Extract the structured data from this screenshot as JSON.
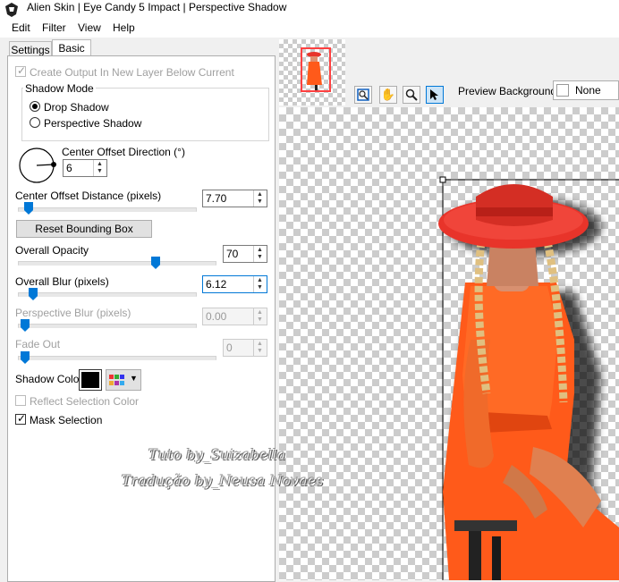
{
  "window": {
    "title": "Alien Skin | Eye Candy 5 Impact | Perspective Shadow"
  },
  "menu": [
    "Edit",
    "Filter",
    "View",
    "Help"
  ],
  "tabs": {
    "settings": "Settings",
    "basic": "Basic"
  },
  "basic": {
    "create_output": {
      "label": "Create Output In New Layer Below Current",
      "checked": true,
      "enabled": false
    },
    "shadow_mode": {
      "title": "Shadow Mode",
      "options": [
        "Drop Shadow",
        "Perspective Shadow"
      ],
      "selected": "Drop Shadow"
    },
    "center_offset_direction": {
      "label": "Center Offset Direction (°)",
      "value": "6"
    },
    "center_offset_distance": {
      "label": "Center Offset Distance (pixels)",
      "value": "7.70",
      "slider_fraction": 0.04
    },
    "reset_button": "Reset Bounding Box",
    "overall_opacity": {
      "label": "Overall Opacity",
      "value": "70",
      "slider_fraction": 0.7
    },
    "overall_blur": {
      "label": "Overall Blur (pixels)",
      "value": "6.12",
      "slider_fraction": 0.06
    },
    "perspective_blur": {
      "label": "Perspective Blur (pixels)",
      "value": "0.00",
      "slider_fraction": 0.0
    },
    "fade_out": {
      "label": "Fade Out",
      "value": "0",
      "slider_fraction": 0.0
    },
    "shadow_color": {
      "label": "Shadow Color",
      "color": "#000000"
    },
    "reflect_selection_color": {
      "label": "Reflect Selection Color",
      "checked": false
    },
    "mask_selection": {
      "label": "Mask Selection",
      "checked": true
    }
  },
  "preview": {
    "background_label": "Preview Background:",
    "background_value": "None",
    "tools": [
      "zoom-fit-icon",
      "hand-icon",
      "magnifier-icon",
      "pointer-icon"
    ]
  },
  "watermark": {
    "line1": "Tuto by_Suizabella",
    "line2": "Tradução by_Neusa Novaes"
  },
  "colors": {
    "accent": "#0078d7",
    "dress": "#ff5a1a",
    "hat": "#e8342a"
  }
}
